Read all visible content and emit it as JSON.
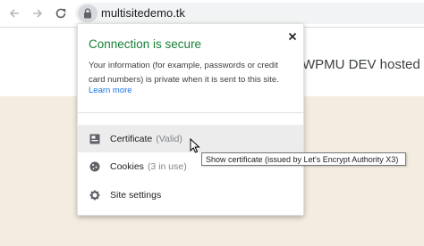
{
  "browser": {
    "url": "multisitedemo.tk"
  },
  "page": {
    "heading": "WPMU DEV hosted Wo"
  },
  "site_info_popup": {
    "title": "Connection is secure",
    "description": "Your information (for example, passwords or credit card numbers) is private when it is sent to this site.",
    "learn_more": "Learn more",
    "items": [
      {
        "label": "Certificate",
        "status": "(Valid)",
        "icon": "certificate-icon"
      },
      {
        "label": "Cookies",
        "status": "(3 in use)",
        "icon": "cookie-icon"
      },
      {
        "label": "Site settings",
        "status": "",
        "icon": "gear-icon"
      }
    ]
  },
  "tooltip": {
    "text": "Show certificate (issued by Let's Encrypt Authority X3)"
  },
  "colors": {
    "secure_green": "#188038",
    "link_blue": "#1a73e8",
    "page_band": "#f3ecdf"
  }
}
